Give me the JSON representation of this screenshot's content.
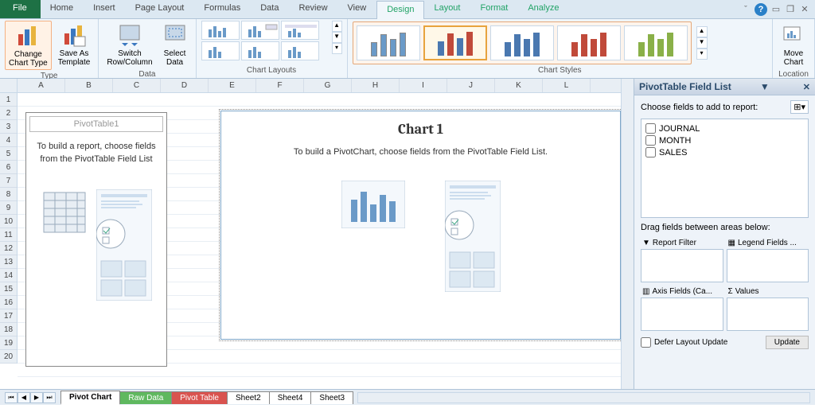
{
  "tabs": {
    "file": "File",
    "items": [
      "Home",
      "Insert",
      "Page Layout",
      "Formulas",
      "Data",
      "Review",
      "View"
    ],
    "context": [
      "Design",
      "Layout",
      "Format",
      "Analyze"
    ],
    "active": "Design"
  },
  "ribbon": {
    "type": {
      "label": "Type",
      "change_chart": "Change\nChart Type",
      "save_template": "Save As\nTemplate"
    },
    "data": {
      "label": "Data",
      "switch": "Switch\nRow/Column",
      "select": "Select\nData"
    },
    "chart_layouts": {
      "label": "Chart Layouts"
    },
    "chart_styles": {
      "label": "Chart Styles"
    },
    "location": {
      "label": "Location",
      "move": "Move\nChart"
    }
  },
  "columns": [
    "A",
    "B",
    "C",
    "D",
    "E",
    "F",
    "G",
    "H",
    "I",
    "J",
    "K",
    "L"
  ],
  "rows": [
    "1",
    "2",
    "3",
    "4",
    "5",
    "6",
    "7",
    "8",
    "9",
    "10",
    "11",
    "12",
    "13",
    "14",
    "15",
    "16",
    "17",
    "18",
    "19",
    "20"
  ],
  "pivot_placeholder": {
    "title": "PivotTable1",
    "text": "To build a report, choose fields from the PivotTable Field List"
  },
  "chart": {
    "title": "Chart 1",
    "instruction": "To build a PivotChart, choose fields from the PivotTable Field List."
  },
  "field_pane": {
    "title": "PivotTable Field List",
    "choose": "Choose fields to add to report:",
    "fields": [
      "JOURNAL",
      "MONTH",
      "SALES"
    ],
    "drag_label": "Drag fields between areas below:",
    "zones": {
      "filter": "Report Filter",
      "legend": "Legend Fields ...",
      "axis": "Axis Fields (Ca...",
      "values": "Values"
    },
    "defer": "Defer Layout Update",
    "update": "Update"
  },
  "sheet_tabs": [
    "Pivot Chart",
    "Raw Data",
    "Pivot Table",
    "Sheet2",
    "Sheet4",
    "Sheet3"
  ]
}
